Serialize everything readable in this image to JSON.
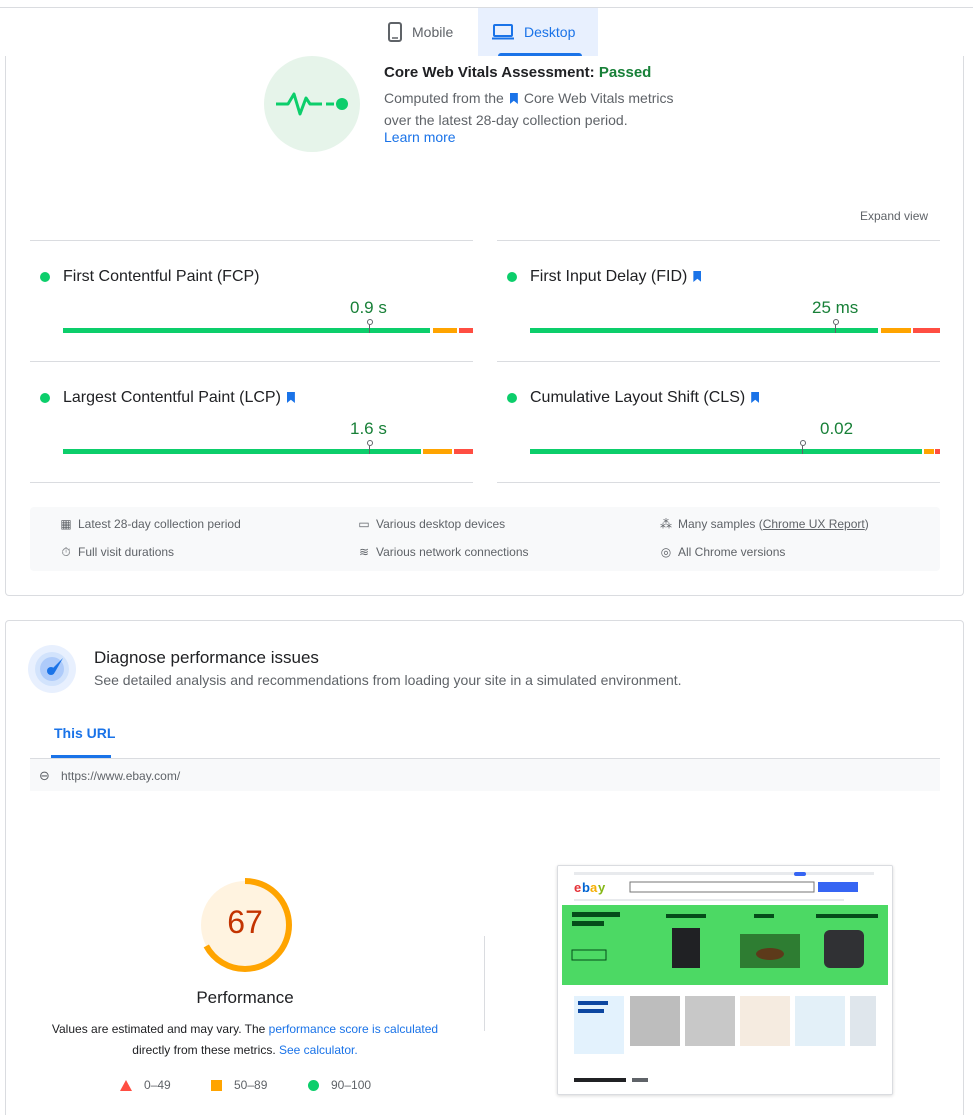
{
  "tabs": {
    "mobile": "Mobile",
    "desktop": "Desktop"
  },
  "cwv": {
    "title": "Core Web Vitals Assessment: ",
    "status": "Passed",
    "desc_before": "Computed from the",
    "desc_link": "Core Web Vitals metrics",
    "desc_after": "over the latest 28-day collection period.",
    "learn_more": "Learn more",
    "expand_view": "Expand view"
  },
  "metrics": [
    {
      "name": "First Contentful Paint (FCP)",
      "value": "0.9 s",
      "bookmark": false
    },
    {
      "name": "First Input Delay (FID)",
      "value": "25 ms",
      "bookmark": true
    },
    {
      "name": "Largest Contentful Paint (LCP)",
      "value": "1.6 s",
      "bookmark": true
    },
    {
      "name": "Cumulative Layout Shift (CLS)",
      "value": "0.02",
      "bookmark": true
    }
  ],
  "info": {
    "period": "Latest 28-day collection period",
    "devices": "Various desktop devices",
    "samples_prefix": "Many samples (",
    "samples_link": "Chrome UX Report",
    "samples_suffix": ")",
    "durations": "Full visit durations",
    "network": "Various network connections",
    "versions": "All Chrome versions"
  },
  "diagnose": {
    "title": "Diagnose performance issues",
    "subtitle": "See detailed analysis and recommendations from loading your site in a simulated environment.",
    "tab": "This URL",
    "url": "https://www.ebay.com/"
  },
  "performance": {
    "score": "67",
    "score_fraction": 0.67,
    "label": "Performance",
    "note_1": "Values are estimated and may vary. The ",
    "note_link_1": "performance score is calculated",
    "note_2": "directly from these metrics. ",
    "note_link_2": "See calculator."
  },
  "legend": {
    "fail": "0–49",
    "average": "50–89",
    "pass": "90–100"
  },
  "colors": {
    "accent": "#1a73e8",
    "good": "#0cce6b",
    "average": "#ffa400",
    "poor": "#ff4e42",
    "score": "#c33300"
  }
}
